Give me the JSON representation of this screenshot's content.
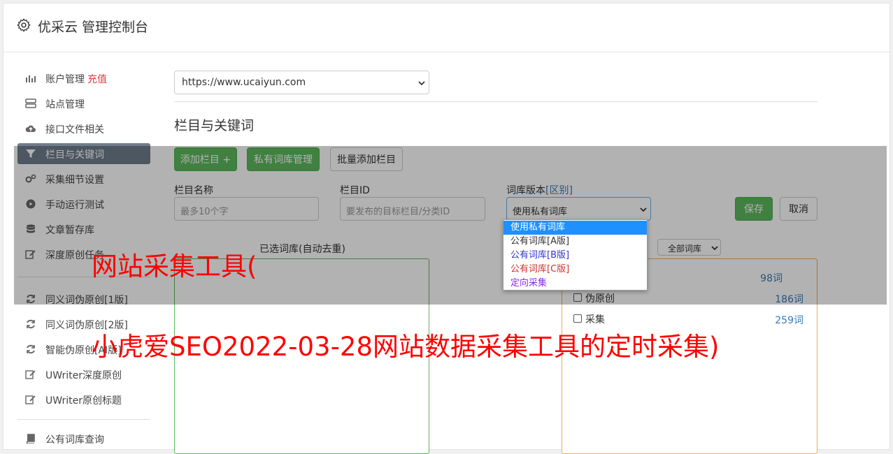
{
  "header": {
    "title": "优采云 管理控制台",
    "icon": "gear-icon"
  },
  "sidebar": {
    "items": [
      {
        "label": "账户管理",
        "badge": "充值",
        "icon": "bar-chart-icon"
      },
      {
        "label": "站点管理",
        "icon": "server-icon"
      },
      {
        "label": "接口文件相关",
        "icon": "cloud-upload-icon"
      },
      {
        "label": "栏目与关键词",
        "icon": "filter-icon",
        "active": true
      },
      {
        "label": "采集细节设置",
        "icon": "cogs-icon"
      },
      {
        "label": "手动运行测试",
        "icon": "play-circle-icon"
      },
      {
        "label": "文章暂存库",
        "icon": "database-icon"
      },
      {
        "label": "深度原创任务",
        "icon": "edit-icon"
      },
      {
        "label": "同义词伪原创[1版]",
        "icon": "refresh-icon"
      },
      {
        "label": "同义词伪原创[2版]",
        "icon": "refresh-icon"
      },
      {
        "label": "智能伪原创[AI版]",
        "icon": "refresh-icon"
      },
      {
        "label": "UWriter深度原创",
        "icon": "edit-icon"
      },
      {
        "label": "UWriter原创标题",
        "icon": "edit-icon"
      },
      {
        "label": "公有词库查询",
        "icon": "book-icon"
      }
    ]
  },
  "main": {
    "site_select": "https://www.ucaiyun.com",
    "section_title": "栏目与关键词",
    "buttons": {
      "add_column": "添加栏目 +",
      "private_lib": "私有词库管理",
      "batch_add": "批量添加栏目",
      "save": "保存",
      "cancel": "取消"
    },
    "form": {
      "name_label": "栏目名称",
      "name_placeholder": "最多10个字",
      "id_label": "栏目ID",
      "id_placeholder": "要发布的目标栏目/分类ID",
      "lib_label": "词库版本",
      "lib_label_link": "[区别]",
      "lib_value": "使用私有词库"
    },
    "dropdown_options": [
      {
        "label": "使用私有词库",
        "color": "#ffffff",
        "selected": true
      },
      {
        "label": "公有词库[A版]",
        "color": "#333333"
      },
      {
        "label": "公有词库[B版]",
        "color": "#3333cc"
      },
      {
        "label": "公有词库[C版]",
        "color": "#cc3333"
      },
      {
        "label": "定向采集",
        "color": "#8a2be2"
      }
    ],
    "selected_lib_label": "已选词库(自动去重)",
    "all_lib_filter": "全部词库",
    "libraries": [
      {
        "name": "伪原创",
        "count": "186词"
      },
      {
        "name": "采集",
        "count": "259词"
      }
    ],
    "first_lib_count": "98词"
  },
  "watermark": {
    "line1": "网站采集工具(",
    "line2": "小虎爱SEO2022-03-28网站数据采集工具的定时采集)"
  },
  "colors": {
    "accent_green": "#5cb85c",
    "link_blue": "#337ab7",
    "watermark_red": "#ff0000",
    "left_box_border": "#5cb85c",
    "right_box_border": "#f0ad4e"
  }
}
